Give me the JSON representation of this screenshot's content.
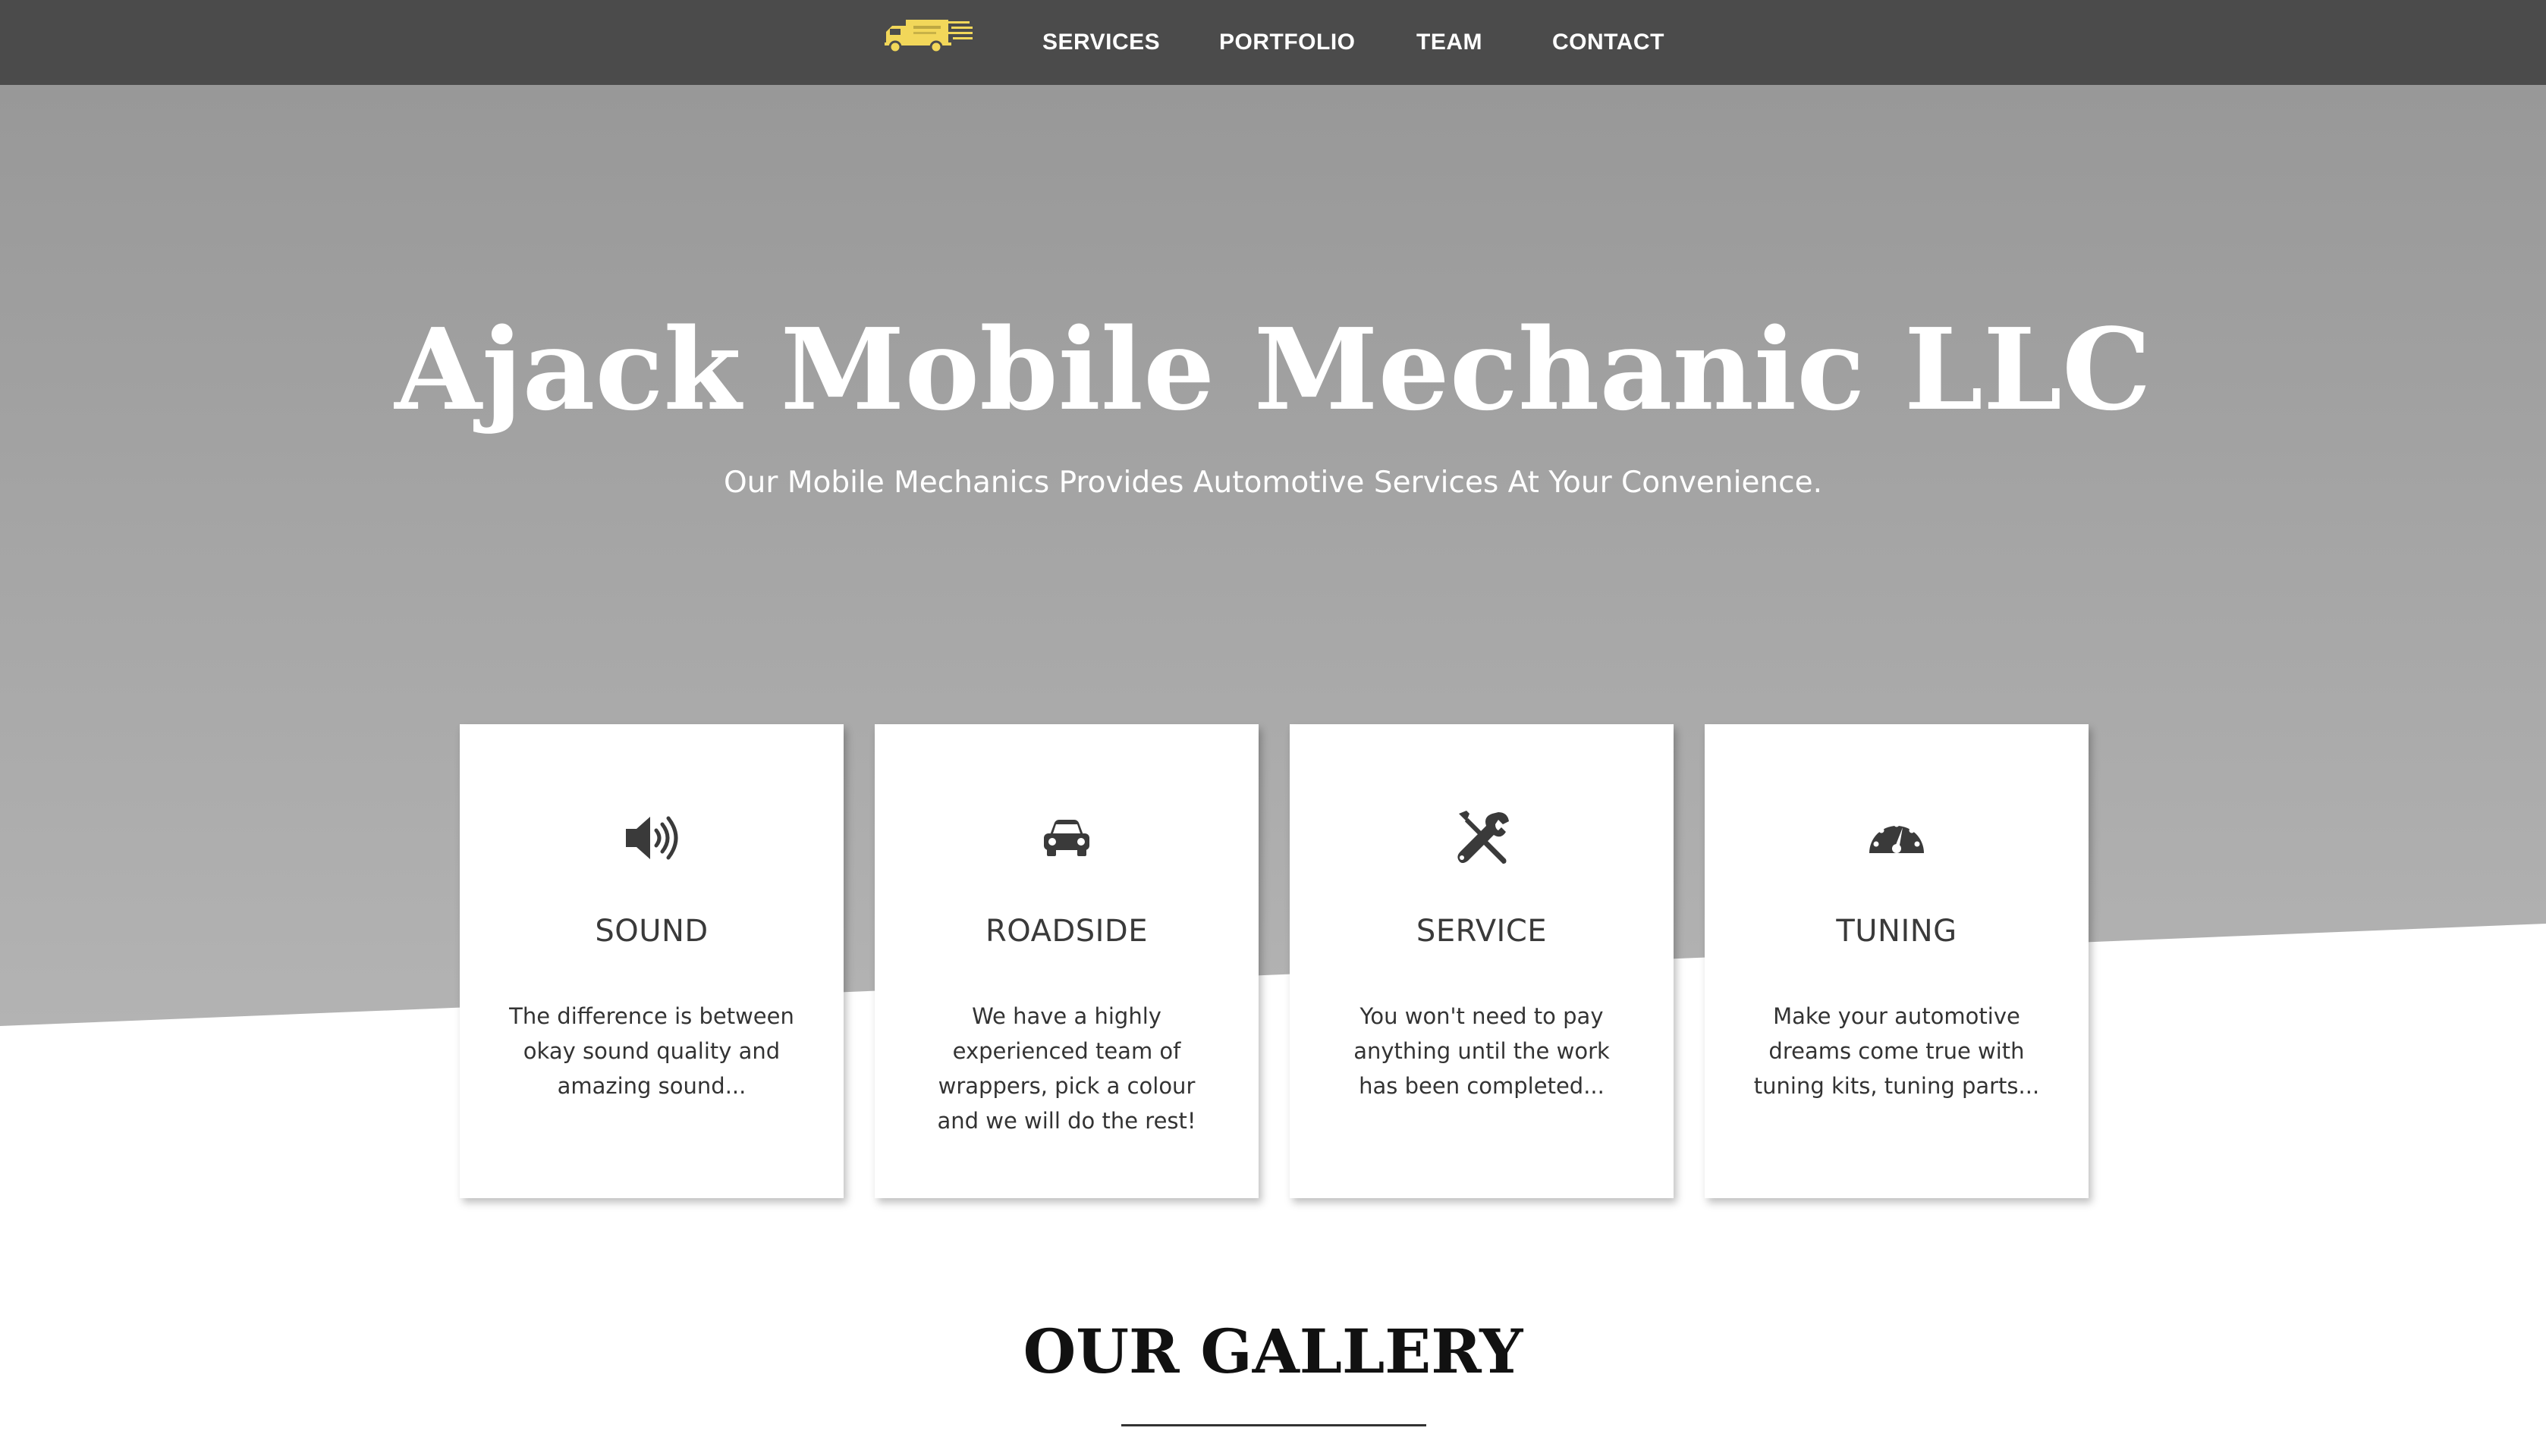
{
  "nav": {
    "logo_icon": "delivery-truck-logo",
    "items": [
      {
        "label": "SERVICES"
      },
      {
        "label": "PORTFOLIO"
      },
      {
        "label": "TEAM"
      },
      {
        "label": "CONTACT"
      }
    ]
  },
  "hero": {
    "title": "Ajack Mobile Mechanic LLC",
    "subtitle": "Our Mobile Mechanics Provides Automotive Services At Your Convenience."
  },
  "cards": [
    {
      "icon": "speaker-icon",
      "title": "SOUND",
      "text": "The difference is between okay sound quality and amazing sound..."
    },
    {
      "icon": "car-icon",
      "title": "ROADSIDE",
      "text": "We have a highly experienced team of wrappers, pick a colour and we will do the rest!"
    },
    {
      "icon": "wrench-screwdriver-icon",
      "title": "SERVICE",
      "text": "You won't need to pay anything until the work has been completed..."
    },
    {
      "icon": "speedometer-icon",
      "title": "TUNING",
      "text": "Make your automotive dreams come true with tuning kits, tuning parts..."
    }
  ],
  "gallery": {
    "title": "OUR GALLERY"
  },
  "colors": {
    "nav_bg": "#4b4b4b",
    "hero_top": "#989898",
    "hero_bottom": "#b3b3b3",
    "logo_yellow": "#f2d75a",
    "icon": "#3a3a3a"
  }
}
